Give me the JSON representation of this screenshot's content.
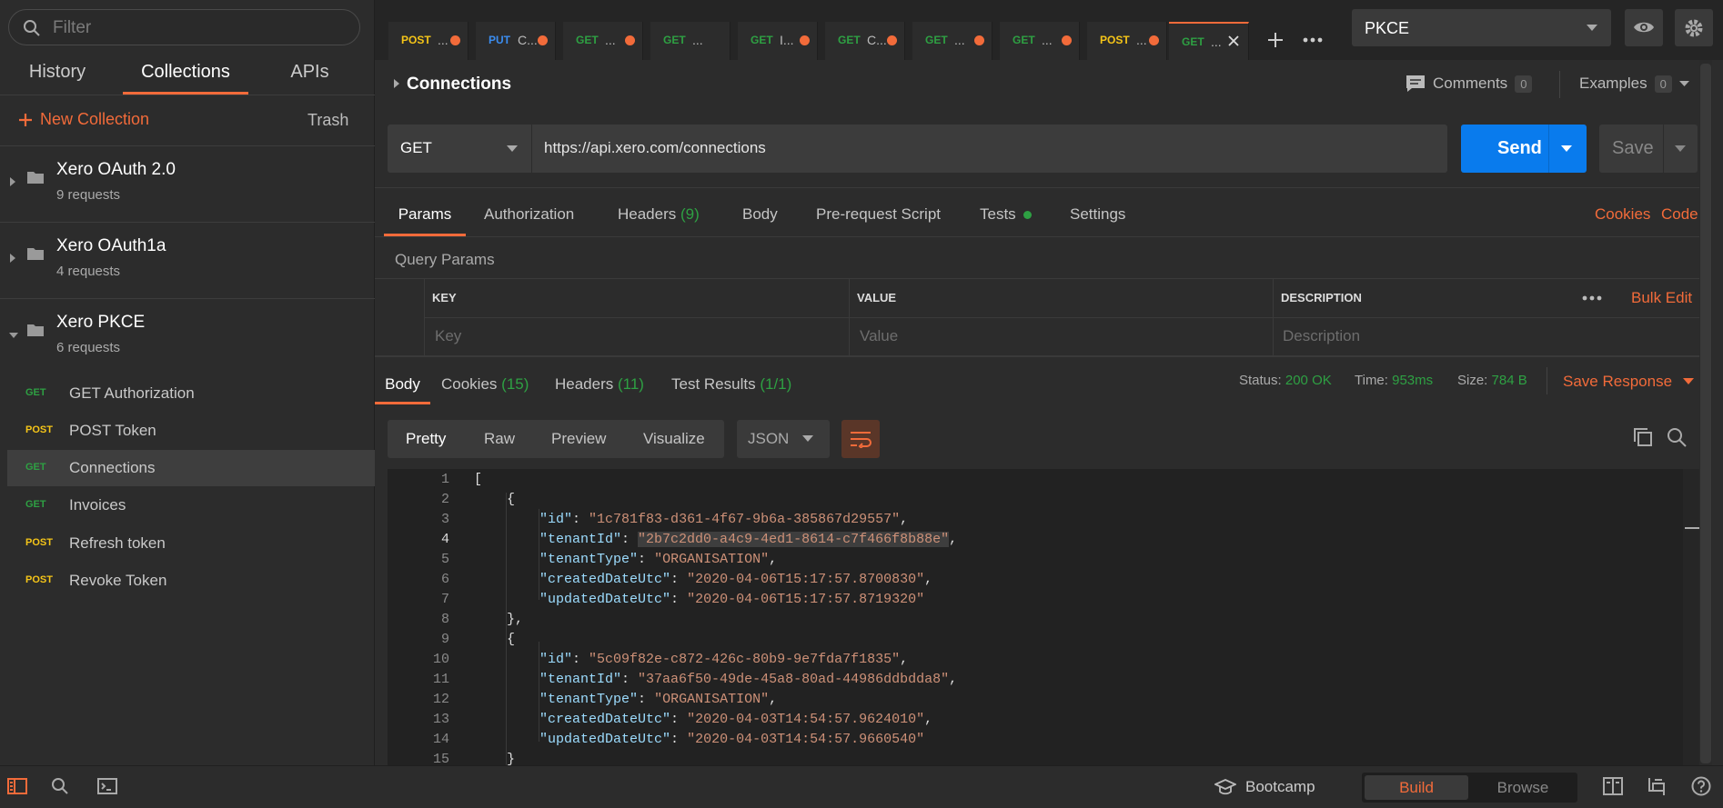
{
  "sidebar": {
    "filter_placeholder": "Filter",
    "tabs": [
      "History",
      "Collections",
      "APIs"
    ],
    "new_collection": "New Collection",
    "trash": "Trash",
    "collections": [
      {
        "name": "Xero OAuth 2.0",
        "count": "9 requests",
        "expanded": false
      },
      {
        "name": "Xero OAuth1a",
        "count": "4 requests",
        "expanded": false
      },
      {
        "name": "Xero PKCE",
        "count": "6 requests",
        "expanded": true
      }
    ],
    "requests": [
      {
        "method": "GET",
        "name": "GET Authorization"
      },
      {
        "method": "POST",
        "name": "POST Token"
      },
      {
        "method": "GET",
        "name": "Connections",
        "selected": true
      },
      {
        "method": "GET",
        "name": "Invoices"
      },
      {
        "method": "POST",
        "name": "Refresh token"
      },
      {
        "method": "POST",
        "name": "Revoke Token"
      }
    ]
  },
  "tabs": [
    {
      "method": "POST",
      "name": "..."
    },
    {
      "method": "PUT",
      "name": "C..."
    },
    {
      "method": "GET",
      "name": "..."
    },
    {
      "method": "GET",
      "name": "..."
    },
    {
      "method": "GET",
      "name": "I..."
    },
    {
      "method": "GET",
      "name": "C..."
    },
    {
      "method": "GET",
      "name": "..."
    },
    {
      "method": "GET",
      "name": "..."
    },
    {
      "method": "POST",
      "name": "..."
    },
    {
      "method": "GET",
      "name": "..."
    }
  ],
  "environment": "PKCE",
  "request": {
    "title": "Connections",
    "comments_label": "Comments",
    "comments_count": "0",
    "examples_label": "Examples",
    "examples_count": "0",
    "method": "GET",
    "url": "https://api.xero.com/connections",
    "send": "Send",
    "save": "Save",
    "tabs": {
      "params": "Params",
      "authorization": "Authorization",
      "headers": "Headers",
      "headers_count": "(9)",
      "body": "Body",
      "prerequest": "Pre-request Script",
      "tests": "Tests",
      "settings": "Settings",
      "cookies": "Cookies",
      "code": "Code"
    },
    "query_params_title": "Query Params",
    "columns": {
      "key": "KEY",
      "value": "VALUE",
      "description": "DESCRIPTION"
    },
    "bulk_edit": "Bulk Edit",
    "placeholders": {
      "key": "Key",
      "value": "Value",
      "description": "Description"
    }
  },
  "response": {
    "tabs": {
      "body": "Body",
      "cookies": "Cookies",
      "cookies_count": "(15)",
      "headers": "Headers",
      "headers_count": "(11)",
      "tests": "Test Results",
      "tests_count": "(1/1)"
    },
    "status_label": "Status:",
    "status": "200 OK",
    "time_label": "Time:",
    "time": "953ms",
    "size_label": "Size:",
    "size": "784 B",
    "save_response": "Save Response",
    "views": [
      "Pretty",
      "Raw",
      "Preview",
      "Visualize"
    ],
    "format": "JSON",
    "lines": [
      {
        "n": "1",
        "text": "["
      },
      {
        "n": "2",
        "text": "    {"
      },
      {
        "n": "3",
        "key": "\"id\"",
        "val": "\"1c781f83-d361-4f67-9b6a-385867d29557\"",
        "end": ","
      },
      {
        "n": "4",
        "key": "\"tenantId\"",
        "val": "\"2b7c2dd0-a4c9-4ed1-8614-c7f466f8b88e\"",
        "end": ","
      },
      {
        "n": "5",
        "key": "\"tenantType\"",
        "val": "\"ORGANISATION\"",
        "end": ","
      },
      {
        "n": "6",
        "key": "\"createdDateUtc\"",
        "val": "\"2020-04-06T15:17:57.8700830\"",
        "end": ","
      },
      {
        "n": "7",
        "key": "\"updatedDateUtc\"",
        "val": "\"2020-04-06T15:17:57.8719320\"",
        "end": ""
      },
      {
        "n": "8",
        "text": "    },"
      },
      {
        "n": "9",
        "text": "    {"
      },
      {
        "n": "10",
        "key": "\"id\"",
        "val": "\"5c09f82e-c872-426c-80b9-9e7fda7f1835\"",
        "end": ","
      },
      {
        "n": "11",
        "key": "\"tenantId\"",
        "val": "\"37aa6f50-49de-45a8-80ad-44986ddbdda8\"",
        "end": ","
      },
      {
        "n": "12",
        "key": "\"tenantType\"",
        "val": "\"ORGANISATION\"",
        "end": ","
      },
      {
        "n": "13",
        "key": "\"createdDateUtc\"",
        "val": "\"2020-04-03T14:54:57.9624010\"",
        "end": ","
      },
      {
        "n": "14",
        "key": "\"updatedDateUtc\"",
        "val": "\"2020-04-03T14:54:57.9660540\"",
        "end": ""
      },
      {
        "n": "15",
        "text": "    }"
      }
    ]
  },
  "footer": {
    "bootcamp": "Bootcamp",
    "build": "Build",
    "browse": "Browse"
  },
  "colors": {
    "accent": "#f26b3a",
    "send": "#097bed",
    "get": "#2ea043",
    "post": "#f5c518",
    "put": "#3b8df0"
  }
}
